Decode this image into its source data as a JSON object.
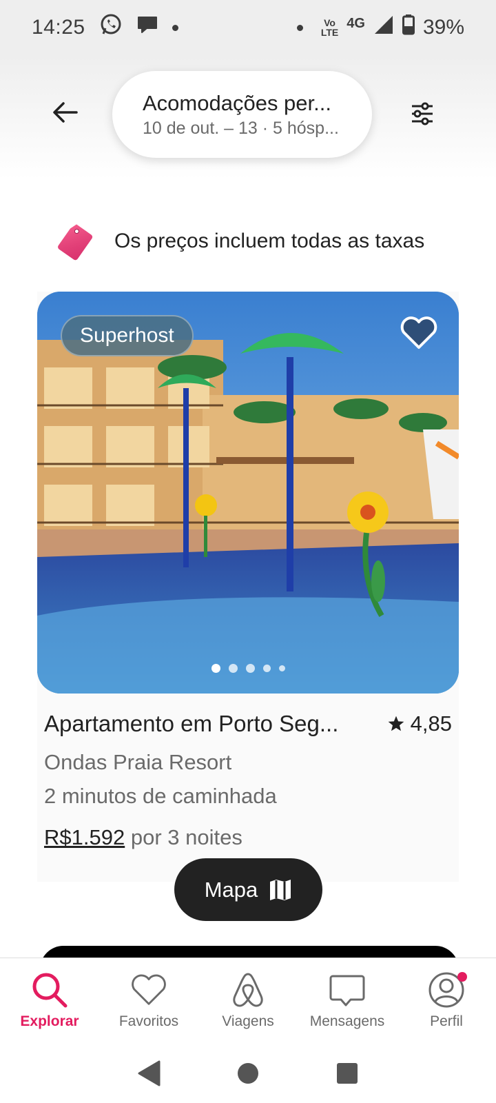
{
  "status_bar": {
    "time": "14:25",
    "volte_top": "Vo",
    "volte_bottom": "LTE",
    "network": "4G",
    "battery": "39%",
    "icons": [
      "whatsapp-icon",
      "chat-bubble-icon",
      "notification-dot",
      "wifi-calling-icon",
      "signal-icon",
      "battery-icon"
    ]
  },
  "header": {
    "search_title": "Acomodações per...",
    "search_subtitle": "10 de out. – 13 · 5 hósp...",
    "back_icon": "arrow-left-icon",
    "filters_icon": "sliders-icon"
  },
  "fees_banner": {
    "text": "Os preços incluem todas as taxas",
    "icon": "price-tag-icon"
  },
  "listing": {
    "badge": "Superhost",
    "title": "Apartamento em Porto Seg...",
    "rating": "4,85",
    "subtitle": "Ondas Praia Resort",
    "distance": "2 minutos de caminhada",
    "price": "R$1.592",
    "price_suffix": "por 3 noites",
    "photo_count_dots": 5,
    "active_photo": 1
  },
  "map_button": {
    "label": "Mapa",
    "icon": "map-icon"
  },
  "bottom_nav": {
    "items": [
      {
        "label": "Explorar",
        "icon": "search-icon",
        "active": true
      },
      {
        "label": "Favoritos",
        "icon": "heart-icon",
        "active": false
      },
      {
        "label": "Viagens",
        "icon": "airbnb-logo-icon",
        "active": false
      },
      {
        "label": "Mensagens",
        "icon": "message-icon",
        "active": false
      },
      {
        "label": "Perfil",
        "icon": "profile-icon",
        "active": false
      }
    ]
  },
  "colors": {
    "accent": "#E31C5F",
    "text_primary": "#222222",
    "text_secondary": "#6A6A6A"
  }
}
